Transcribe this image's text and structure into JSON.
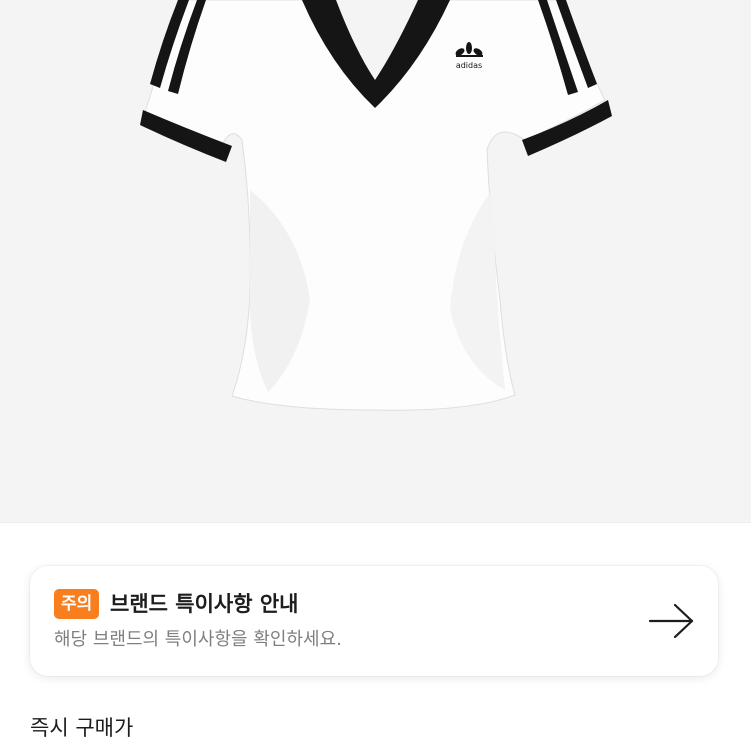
{
  "product": {
    "image_alt": "white v-neck t-shirt with black three-stripe sleeves",
    "logo_text": "adidas"
  },
  "notice": {
    "badge": "주의",
    "title": "브랜드 특이사항 안내",
    "description": "해당 브랜드의 특이사항을 확인하세요.",
    "arrow_icon": "arrow-right-icon",
    "badge_color": "#f97f1e"
  },
  "section": {
    "label": "즉시 구매가"
  }
}
